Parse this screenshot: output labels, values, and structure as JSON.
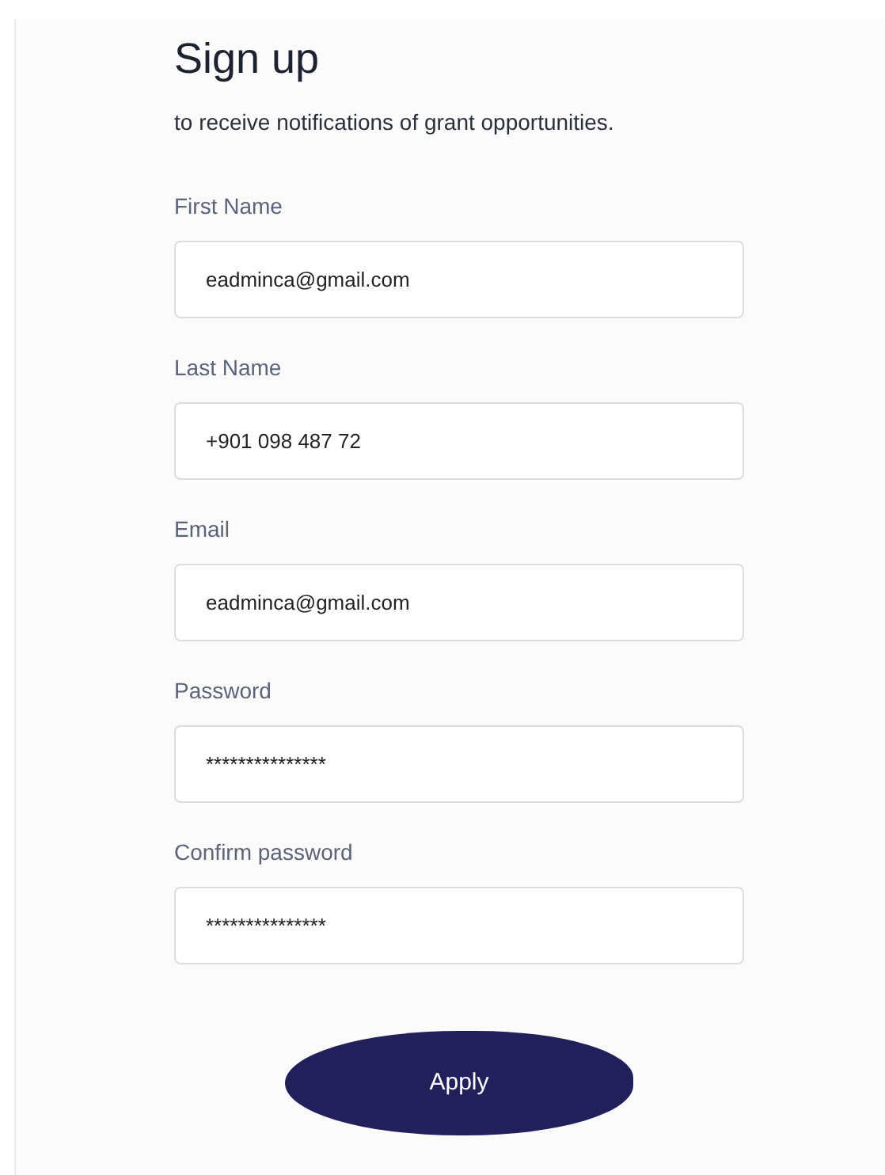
{
  "title": "Sign up",
  "subtitle": "to receive notifications of grant opportunities.",
  "fields": [
    {
      "label": "First Name",
      "value": "eadminca@gmail.com"
    },
    {
      "label": "Last Name",
      "value": "+901 098 487 72"
    },
    {
      "label": "Email",
      "value": "eadminca@gmail.com"
    },
    {
      "label": "Password",
      "value": "***************"
    },
    {
      "label": "Confirm password",
      "value": "***************"
    }
  ],
  "button": "Apply"
}
